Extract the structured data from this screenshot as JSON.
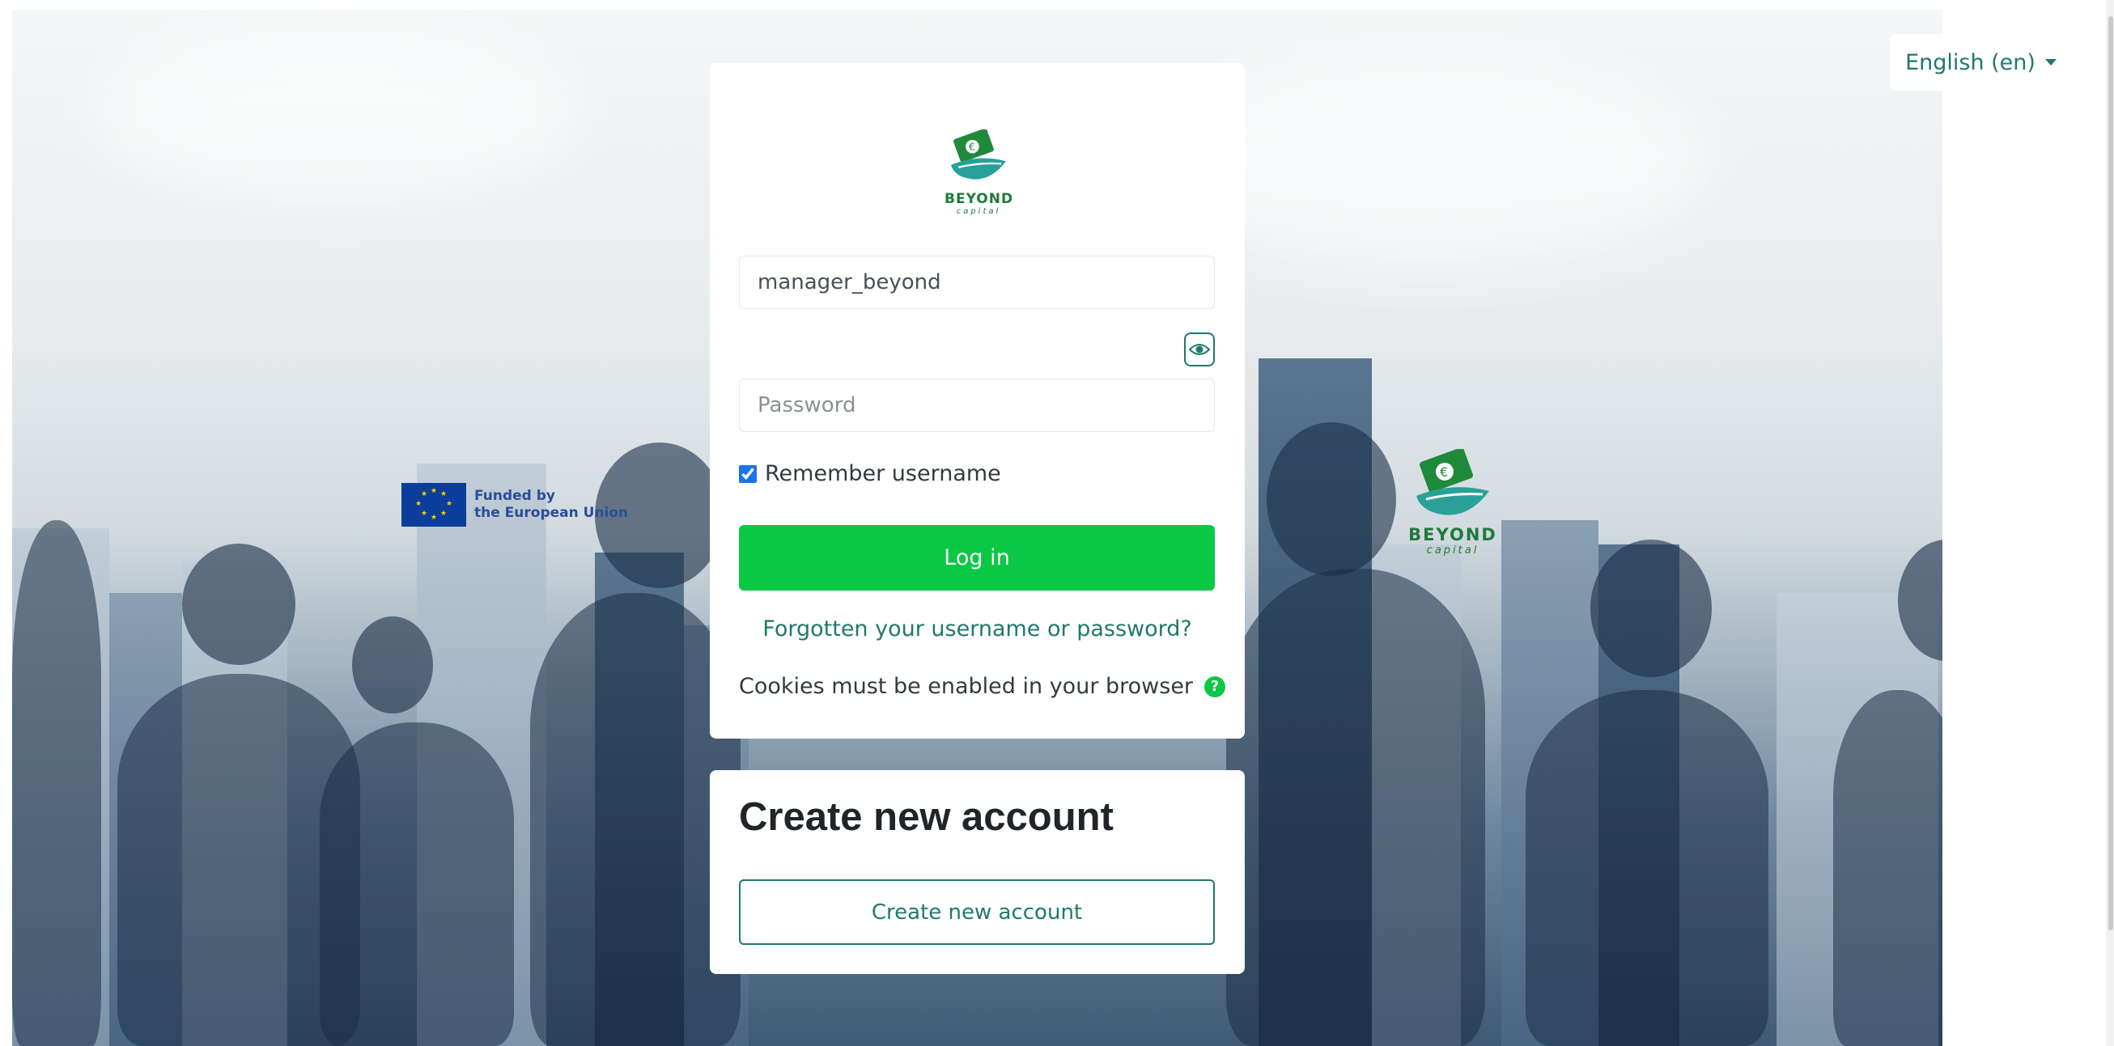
{
  "language": {
    "selected": "English (en)"
  },
  "background": {
    "eu_logo_line1": "Funded by",
    "eu_logo_line2": "the European Union",
    "brand_name": "BEYOND",
    "brand_sub": "capital"
  },
  "login": {
    "logo_name": "BEYOND",
    "logo_sub": "capital",
    "username_value": "manager_beyond",
    "password_placeholder": "Password",
    "remember_label": "Remember username",
    "remember_checked": true,
    "login_button": "Log in",
    "forgot_link": "Forgotten your username or password?",
    "cookies_text": "Cookies must be enabled in your browser"
  },
  "signup": {
    "heading": "Create new account",
    "button": "Create new account"
  },
  "colors": {
    "primary_green": "#0ac844",
    "teal": "#1f7a6a",
    "brand_dark_green": "#1f7a3a"
  }
}
